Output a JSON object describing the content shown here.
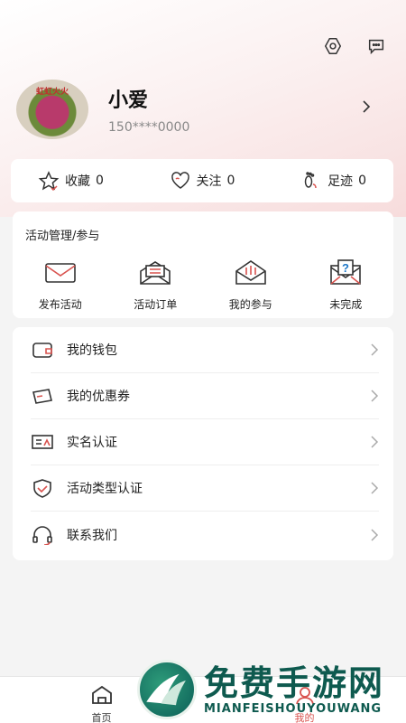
{
  "colors": {
    "accent": "#d9534f",
    "header_gradient_end": "#f7dcdc",
    "watermark": "#0e5a4f"
  },
  "header": {
    "icons": [
      "settings-icon",
      "message-icon"
    ]
  },
  "profile": {
    "avatar_text": "虹虹火火",
    "name": "小爱",
    "phone": "150****0000"
  },
  "stats": [
    {
      "label": "收藏",
      "count": "0",
      "icon": "star-icon"
    },
    {
      "label": "关注",
      "count": "0",
      "icon": "heart-icon"
    },
    {
      "label": "足迹",
      "count": "0",
      "icon": "footprint-icon"
    }
  ],
  "activity": {
    "title": "活动管理/参与",
    "items": [
      {
        "label": "发布活动",
        "icon": "envelope-icon"
      },
      {
        "label": "活动订单",
        "icon": "order-envelope-icon"
      },
      {
        "label": "我的参与",
        "icon": "open-envelope-icon"
      },
      {
        "label": "未完成",
        "icon": "question-envelope-icon"
      }
    ]
  },
  "menu": [
    {
      "label": "我的钱包",
      "icon": "wallet-icon"
    },
    {
      "label": "我的优惠券",
      "icon": "coupon-icon"
    },
    {
      "label": "实名认证",
      "icon": "id-card-icon"
    },
    {
      "label": "活动类型认证",
      "icon": "shield-check-icon"
    },
    {
      "label": "联系我们",
      "icon": "headset-icon"
    }
  ],
  "tabbar": [
    {
      "label": "首页",
      "icon": "home-icon"
    },
    {
      "label": "我的",
      "icon": "user-icon",
      "active": true
    }
  ],
  "watermark": {
    "cn": "免费手游网",
    "en": "MIANFEISHOUYOUWANG"
  }
}
